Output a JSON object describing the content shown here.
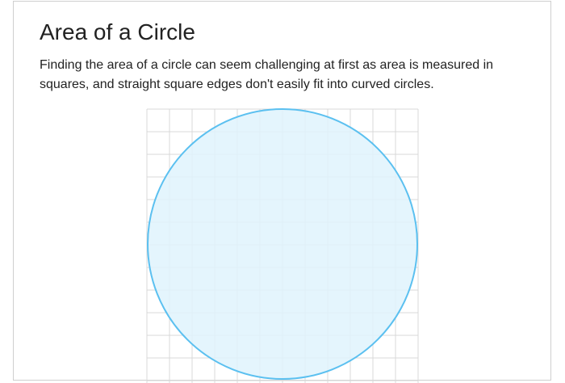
{
  "lesson": {
    "title": "Area of a Circle",
    "intro": "Finding the area of a circle can seem challenging at first as area is measured in squares, and straight square edges don't easily fit into curved circles."
  },
  "figure": {
    "grid_color": "#d9d9d9",
    "circle_stroke": "#5bc0f0",
    "circle_fill": "#dff3fd"
  }
}
